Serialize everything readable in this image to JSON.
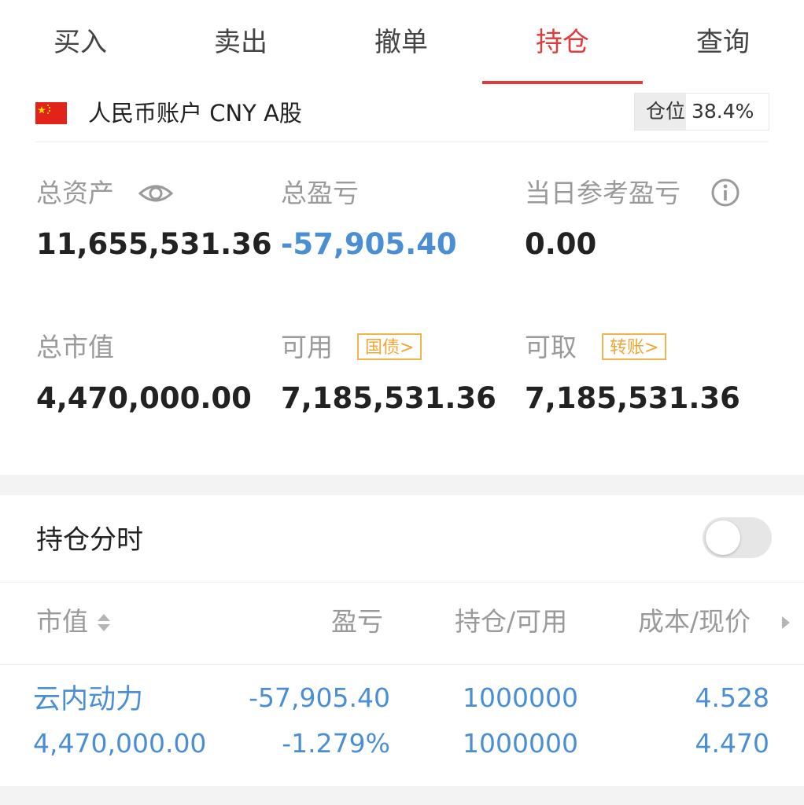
{
  "tabs": [
    {
      "label": "买入"
    },
    {
      "label": "卖出"
    },
    {
      "label": "撤单"
    },
    {
      "label": "持仓"
    },
    {
      "label": "查询"
    }
  ],
  "active_tab_index": 3,
  "colors": {
    "accent_red": "#e03a3a",
    "value_blue": "#4a8fd6",
    "tag_orange": "#f0a733",
    "label_gray": "#9a9a9a"
  },
  "account": {
    "flag_icon": "china-flag-icon",
    "label": "人民币账户 CNY A股",
    "position_label": "仓位 38.4%",
    "position_fraction": 0.384
  },
  "summary": {
    "total_assets": {
      "label": "总资产",
      "value": "11,655,531.36",
      "icon": "eye-icon"
    },
    "total_pnl": {
      "label": "总盈亏",
      "value": "-57,905.40"
    },
    "daily_pnl": {
      "label": "当日参考盈亏",
      "value": "0.00",
      "icon": "info-icon"
    },
    "market_value": {
      "label": "总市值",
      "value": "4,470,000.00"
    },
    "available": {
      "label": "可用",
      "value": "7,185,531.36",
      "tag": "国债>"
    },
    "withdrawable": {
      "label": "可取",
      "value": "7,185,531.36",
      "tag": "转账>"
    }
  },
  "holding_timeshare": {
    "label": "持仓分时",
    "enabled": false
  },
  "table": {
    "headers": [
      "市值",
      "盈亏",
      "持仓/可用",
      "成本/现价"
    ],
    "rows": [
      {
        "name": "云内动力",
        "market_value": "4,470,000.00",
        "pnl": "-57,905.40",
        "pnl_pct": "-1.279%",
        "position": "1000000",
        "available": "1000000",
        "cost": "4.528",
        "price": "4.470"
      }
    ]
  }
}
